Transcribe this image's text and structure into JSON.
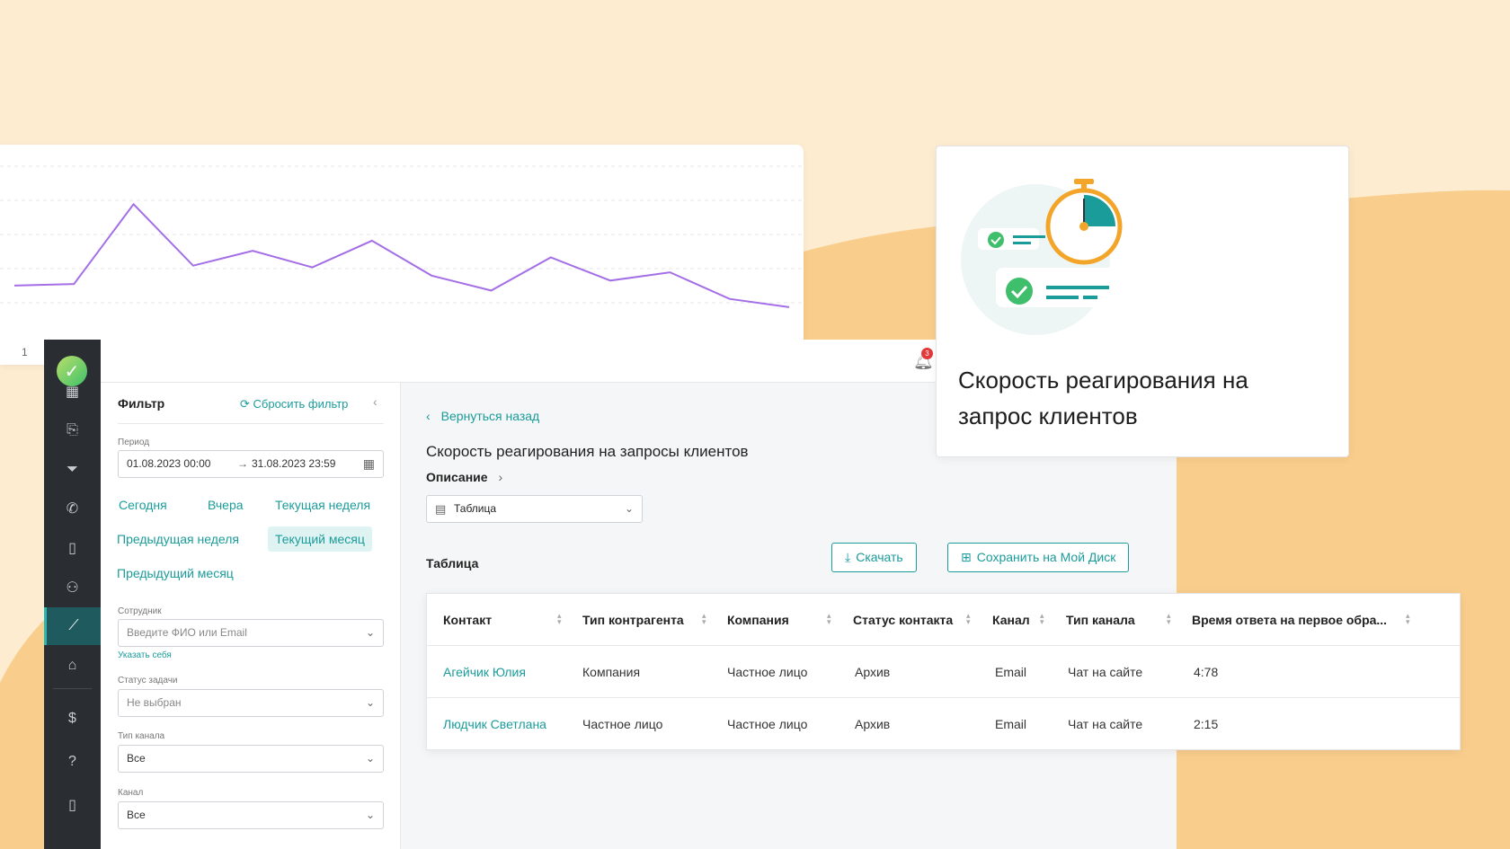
{
  "chart": {
    "type": "line",
    "color": "#a46fe6",
    "values": [
      0.26,
      0.27,
      0.75,
      0.38,
      0.47,
      0.37,
      0.53,
      0.32,
      0.23,
      0.43,
      0.29,
      0.34,
      0.18,
      0.13
    ],
    "tick_label": "1"
  },
  "topbar": {
    "notification_count": "3"
  },
  "sidebar": {
    "items": [
      {
        "icon": "grid-icon",
        "glyph": "▦"
      },
      {
        "icon": "clipboard-icon",
        "glyph": "⎘"
      },
      {
        "icon": "funnel-icon",
        "glyph": "⏷"
      },
      {
        "icon": "phone-icon",
        "glyph": "✆"
      },
      {
        "icon": "book-icon",
        "glyph": "▯"
      },
      {
        "icon": "users-icon",
        "glyph": "⚇"
      },
      {
        "icon": "analytics-icon",
        "glyph": "⟋"
      },
      {
        "icon": "folder-icon",
        "glyph": "⌂"
      },
      {
        "icon": "dollar-icon",
        "glyph": "$"
      },
      {
        "icon": "help-icon",
        "glyph": "?"
      },
      {
        "icon": "mobile-icon",
        "glyph": "▯"
      }
    ]
  },
  "filter": {
    "title": "Фильтр",
    "reset_label": "Сбросить фильтр",
    "period_label": "Период",
    "date_from": "01.08.2023 00:00",
    "date_to": "31.08.2023 23:59",
    "quick_ranges": [
      "Сегодня",
      "Вчера",
      "Текущая неделя",
      "Предыдущая неделя",
      "Текущий месяц",
      "Предыдущий месяц"
    ],
    "employee_label": "Сотрудник",
    "employee_placeholder": "Введите ФИО или Email",
    "self_link": "Указать себя",
    "task_status_label": "Статус задачи",
    "task_status_value": "Не выбран",
    "channel_type_label": "Тип канала",
    "channel_type_value": "Все",
    "channel_label": "Канал",
    "channel_value": "Все"
  },
  "main": {
    "back_label": "Вернуться назад",
    "report_title": "Скорость реагирования на запросы клиентов",
    "description_label": "Описание",
    "view_select": "Таблица",
    "section_label": "Таблица",
    "download_label": "Скачать",
    "save_label": "Сохранить на Мой Диск"
  },
  "table": {
    "columns": [
      "Контакт",
      "Тип контрагента",
      "Компания",
      "Статус контакта",
      "Канал",
      "Тип канала",
      "Время ответа на первое обра..."
    ],
    "rows": [
      [
        "Агейчик Юлия",
        "Компания",
        "Частное лицо",
        "Архив",
        "Email",
        "Чат на сайте",
        "4:78"
      ],
      [
        "Людчик Светлана",
        "Частное лицо",
        "Частное лицо",
        "Архив",
        "Email",
        "Чат на сайте",
        "2:15"
      ]
    ]
  },
  "promo": {
    "title": "Скорость реагирования на запрос клиентов"
  },
  "colors": {
    "accent": "#1a9c9a",
    "background": "#fdecd0",
    "blob": "#f9cd8c",
    "sidebar": "#2a2d31"
  }
}
